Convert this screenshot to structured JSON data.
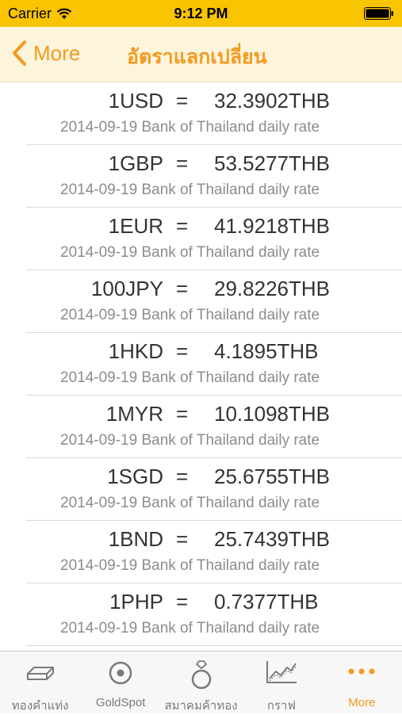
{
  "status_bar": {
    "carrier": "Carrier",
    "time": "9:12 PM"
  },
  "nav": {
    "back_label": "More",
    "title": "อัตราแลกเปลี่ยน"
  },
  "rates": [
    {
      "left": "1USD",
      "eq": "=",
      "right": "32.3902THB",
      "desc": "2014-09-19 Bank of Thailand daily rate"
    },
    {
      "left": "1GBP",
      "eq": "=",
      "right": "53.5277THB",
      "desc": "2014-09-19 Bank of Thailand daily rate"
    },
    {
      "left": "1EUR",
      "eq": "=",
      "right": "41.9218THB",
      "desc": "2014-09-19 Bank of Thailand daily rate"
    },
    {
      "left": "100JPY",
      "eq": "=",
      "right": "29.8226THB",
      "desc": "2014-09-19 Bank of Thailand daily rate"
    },
    {
      "left": "1HKD",
      "eq": "=",
      "right": "4.1895THB",
      "desc": "2014-09-19 Bank of Thailand daily rate"
    },
    {
      "left": "1MYR",
      "eq": "=",
      "right": "10.1098THB",
      "desc": "2014-09-19 Bank of Thailand daily rate"
    },
    {
      "left": "1SGD",
      "eq": "=",
      "right": "25.6755THB",
      "desc": "2014-09-19 Bank of Thailand daily rate"
    },
    {
      "left": "1BND",
      "eq": "=",
      "right": "25.7439THB",
      "desc": "2014-09-19 Bank of Thailand daily rate"
    },
    {
      "left": "1PHP",
      "eq": "=",
      "right": "0.7377THB",
      "desc": "2014-09-19 Bank of Thailand daily rate"
    }
  ],
  "tabs": [
    {
      "label": "ทองคำแท่ง",
      "icon": "gold-bar-icon"
    },
    {
      "label": "GoldSpot",
      "icon": "target-icon"
    },
    {
      "label": "สมาคมค้าทอง",
      "icon": "ring-icon"
    },
    {
      "label": "กราฟ",
      "icon": "chart-icon"
    },
    {
      "label": "More",
      "icon": "more-dots-icon"
    }
  ],
  "colors": {
    "status_bar": "#f9c400",
    "accent": "#f39a1f",
    "nav_bg": "#fdf4dc"
  }
}
